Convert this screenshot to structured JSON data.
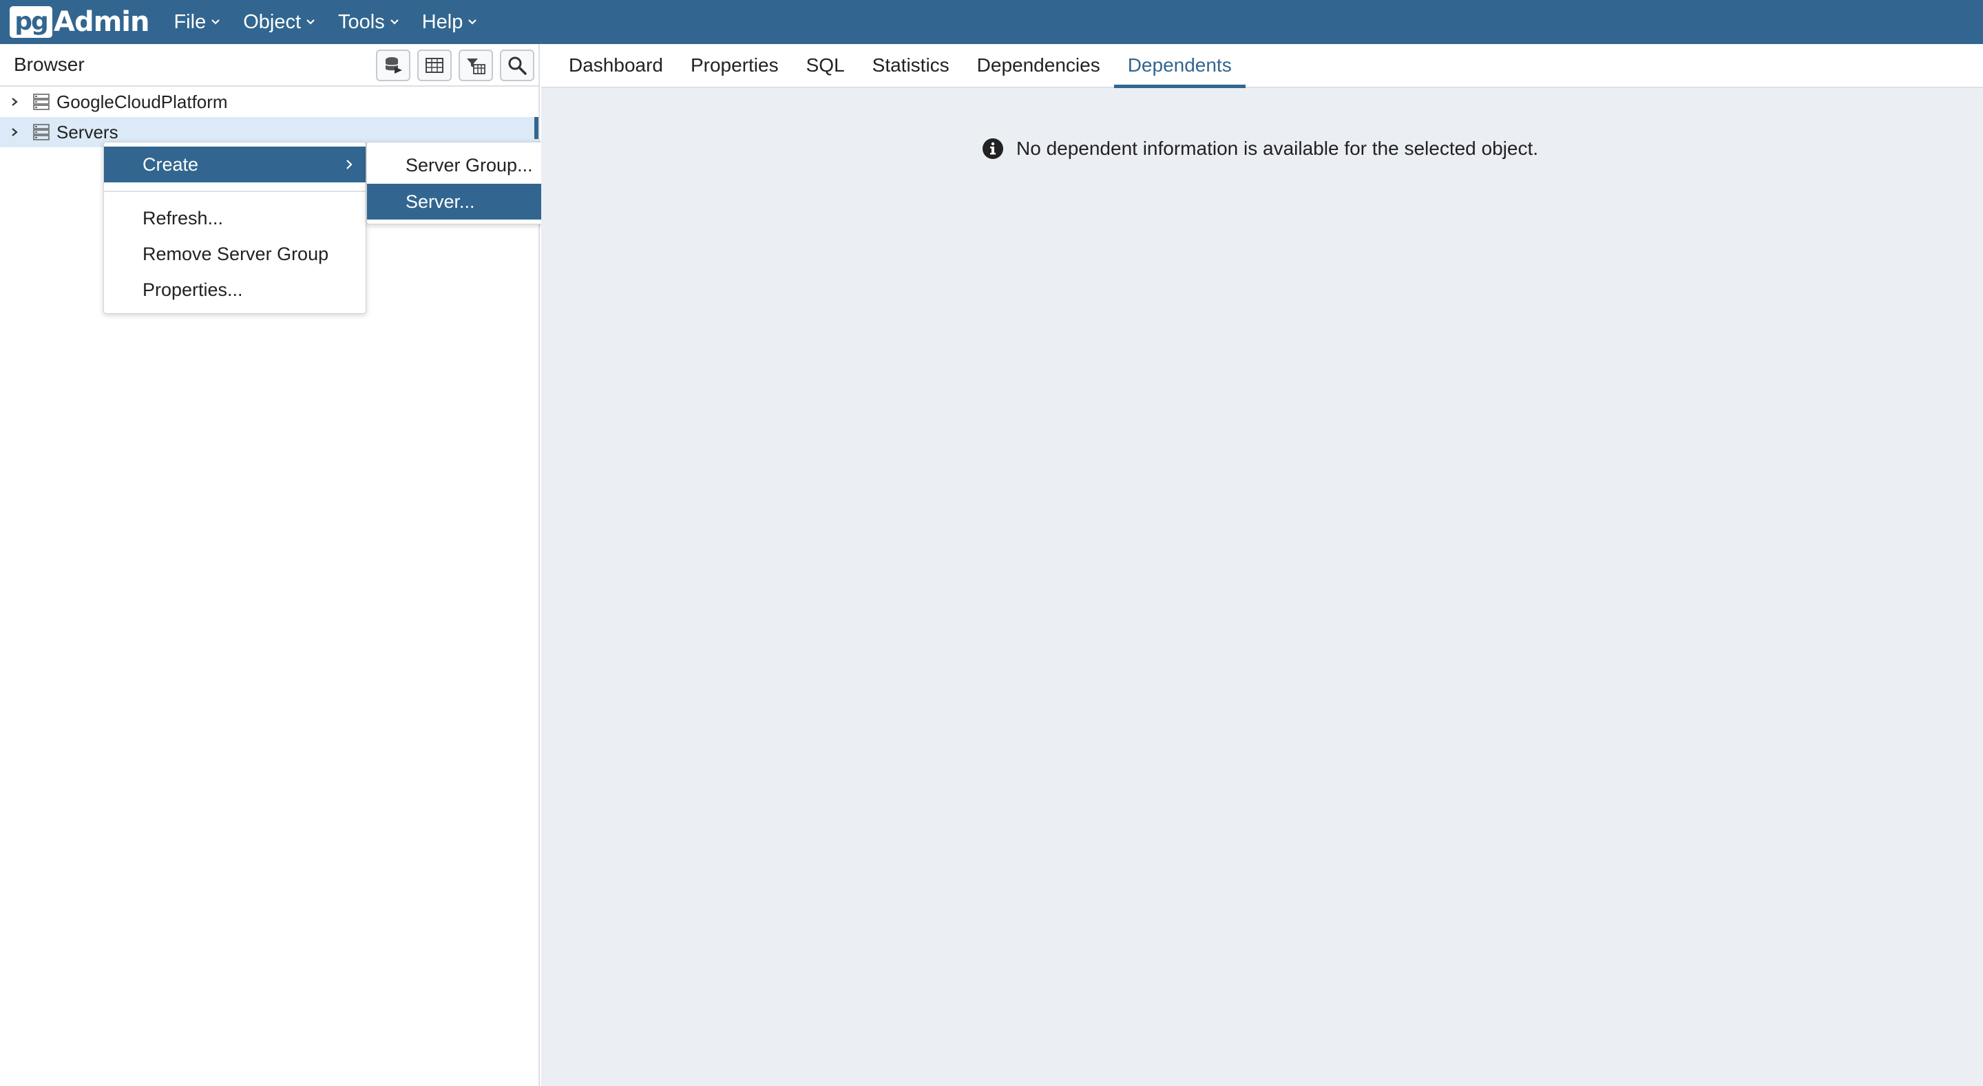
{
  "navbar": {
    "logo_pg": "pg",
    "logo_admin": "Admin",
    "menu": [
      {
        "label": "File"
      },
      {
        "label": "Object"
      },
      {
        "label": "Tools"
      },
      {
        "label": "Help"
      }
    ]
  },
  "browser": {
    "title": "Browser",
    "tools": [
      "query-tool-icon",
      "view-data-icon",
      "filtered-rows-icon",
      "search-objects-icon"
    ],
    "tree": [
      {
        "label": "GoogleCloudPlatform",
        "icon": "server-group-icon",
        "selected": false
      },
      {
        "label": "Servers",
        "icon": "server-group-icon",
        "selected": true
      }
    ]
  },
  "context_menu": {
    "items": [
      {
        "label": "Create",
        "active": true,
        "has_submenu": true
      },
      {
        "label": "Refresh..."
      },
      {
        "label": "Remove Server Group"
      },
      {
        "label": "Properties..."
      }
    ],
    "submenu": [
      {
        "label": "Server Group...",
        "active": false
      },
      {
        "label": "Server...",
        "active": true
      }
    ]
  },
  "tabs": [
    {
      "label": "Dashboard",
      "active": false
    },
    {
      "label": "Properties",
      "active": false
    },
    {
      "label": "SQL",
      "active": false
    },
    {
      "label": "Statistics",
      "active": false
    },
    {
      "label": "Dependencies",
      "active": false
    },
    {
      "label": "Dependents",
      "active": true
    }
  ],
  "main": {
    "message": "No dependent information is available for the selected object."
  },
  "colors": {
    "primary": "#326690",
    "panel_bg": "#ebeef3",
    "selected_row": "#dbeaf6"
  }
}
